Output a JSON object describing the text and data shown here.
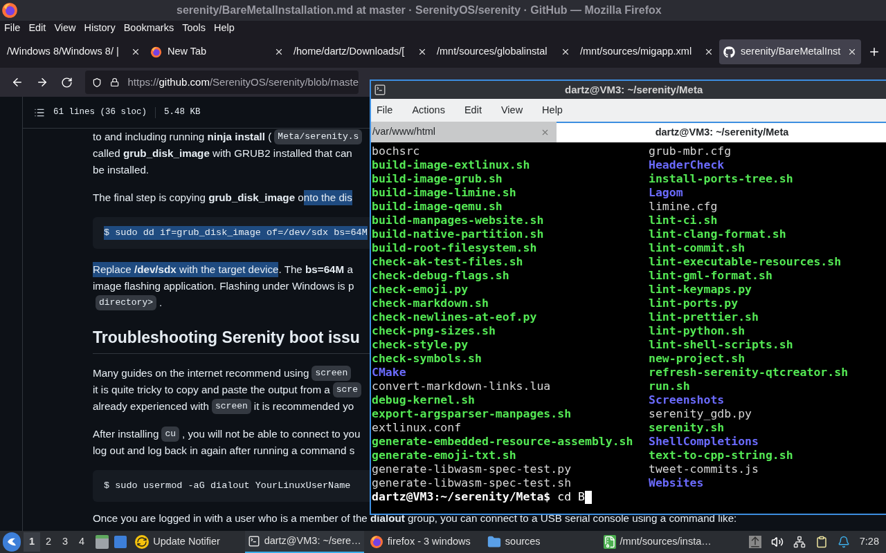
{
  "window": {
    "title": "serenity/BareMetalInstallation.md at master · SerenityOS/serenity · GitHub — Mozilla Firefox"
  },
  "menu": [
    "File",
    "Edit",
    "View",
    "History",
    "Bookmarks",
    "Tools",
    "Help"
  ],
  "tabs": [
    {
      "label": "/Windows 8/Windows 8/ |",
      "kind": "plain",
      "selected": false
    },
    {
      "label": "New Tab",
      "kind": "browser",
      "selected": false
    },
    {
      "label": "/home/dartz/Downloads/[",
      "kind": "plain",
      "selected": false
    },
    {
      "label": "/mnt/sources/globalinstal",
      "kind": "plain",
      "selected": false
    },
    {
      "label": "/mnt/sources/migapp.xml",
      "kind": "plain",
      "selected": false
    },
    {
      "label": "serenity/BareMetalInst",
      "kind": "repo",
      "selected": true
    }
  ],
  "url": {
    "scheme": "https://",
    "domain": "github.com",
    "path": "/SerenityOS/serenity/blob/maste"
  },
  "file_info": {
    "lines": "61 lines (36 sloc)",
    "size": "5.48 KB"
  },
  "article": [
    {
      "kind": "p",
      "lines": [
        [
          {
            "kind": "text",
            "text": "to and including running **ninja install** (",
            "highlighted": false
          },
          {
            "kind": "code",
            "text": "Meta/serenity.s",
            "highlighted": false
          }
        ],
        [
          {
            "kind": "text",
            "text": "called **grub_disk_image** with GRUB2 installed that can",
            "highlighted": false
          }
        ],
        [
          {
            "kind": "text",
            "text": "be installed.",
            "highlighted": false
          }
        ]
      ]
    },
    {
      "kind": "p",
      "lines": [
        [
          {
            "kind": "text",
            "text": "The final step is copying **grub_disk_image** o",
            "highlighted": false
          },
          {
            "kind": "text",
            "text": "nto the dis",
            "highlighted": true
          }
        ]
      ]
    },
    {
      "kind": "codeblock",
      "text": "$ sudo dd if=grub_disk_image of=/dev/sdx bs=64M",
      "highlighted": true
    },
    {
      "kind": "p",
      "lines": [
        [
          {
            "kind": "text",
            "text": "Replace **/dev/sdx** with the target device",
            "highlighted": true
          },
          {
            "kind": "text",
            "text": ". The **bs=64M** a",
            "highlighted": false
          }
        ],
        [
          {
            "kind": "text",
            "text": "image flashing application. Flashing under Windows is p",
            "highlighted": false
          }
        ],
        [
          {
            "kind": "code",
            "text": "directory>",
            "highlighted": false
          },
          {
            "kind": "text",
            "text": ".",
            "highlighted": false
          }
        ]
      ]
    },
    {
      "kind": "heading",
      "text": "Troubleshooting Serenity boot issu"
    },
    {
      "kind": "p",
      "lines": [
        [
          {
            "kind": "text",
            "text": "Many guides on the internet recommend using",
            "highlighted": false
          },
          {
            "kind": "code",
            "text": "screen",
            "highlighted": false
          }
        ],
        [
          {
            "kind": "text",
            "text": "it is quite tricky to copy and paste the output from a",
            "highlighted": false
          },
          {
            "kind": "code",
            "text": "scre",
            "highlighted": false
          }
        ],
        [
          {
            "kind": "text",
            "text": "already experienced with",
            "highlighted": false
          },
          {
            "kind": "code",
            "text": "screen",
            "highlighted": false
          },
          {
            "kind": "text",
            "text": "it is recommended yo",
            "highlighted": false
          }
        ]
      ]
    },
    {
      "kind": "p",
      "lines": [
        [
          {
            "kind": "text",
            "text": "After installing",
            "highlighted": false
          },
          {
            "kind": "code",
            "text": "cu",
            "highlighted": false
          },
          {
            "kind": "text",
            "text": ", you will not be able to connect to you",
            "highlighted": false
          }
        ],
        [
          {
            "kind": "text",
            "text": "log out and log back in again after running a command s",
            "highlighted": false
          }
        ]
      ]
    },
    {
      "kind": "codeblock",
      "text": "$ sudo usermod -aG dialout YourLinuxUserName",
      "highlighted": false
    },
    {
      "kind": "p",
      "lines": [
        [
          {
            "kind": "text",
            "text": "Once you are logged in with a user who is a member of the **dialout** group, you can connect to a USB serial console using a command like:",
            "highlighted": false
          }
        ]
      ]
    }
  ],
  "terminal": {
    "title": "dartz@VM3: ~/serenity/Meta",
    "menu": [
      "File",
      "Actions",
      "Edit",
      "View",
      "Help"
    ],
    "tabs": [
      {
        "label": "/var/www/html",
        "selected": false
      },
      {
        "label": "dartz@VM3: ~/serenity/Meta",
        "selected": true
      }
    ],
    "listing": [
      {
        "name": "bochsrc",
        "kind": "file"
      },
      {
        "name": "grub-mbr.cfg",
        "kind": "file"
      },
      {
        "name": "build-image-extlinux.sh",
        "kind": "exec"
      },
      {
        "name": "HeaderCheck",
        "kind": "dir"
      },
      {
        "name": "build-image-grub.sh",
        "kind": "exec"
      },
      {
        "name": "install-ports-tree.sh",
        "kind": "exec"
      },
      {
        "name": "build-image-limine.sh",
        "kind": "exec"
      },
      {
        "name": "Lagom",
        "kind": "dir"
      },
      {
        "name": "build-image-qemu.sh",
        "kind": "exec"
      },
      {
        "name": "limine.cfg",
        "kind": "file"
      },
      {
        "name": "build-manpages-website.sh",
        "kind": "exec"
      },
      {
        "name": "lint-ci.sh",
        "kind": "exec"
      },
      {
        "name": "build-native-partition.sh",
        "kind": "exec"
      },
      {
        "name": "lint-clang-format.sh",
        "kind": "exec"
      },
      {
        "name": "build-root-filesystem.sh",
        "kind": "exec"
      },
      {
        "name": "lint-commit.sh",
        "kind": "exec"
      },
      {
        "name": "check-ak-test-files.sh",
        "kind": "exec"
      },
      {
        "name": "lint-executable-resources.sh",
        "kind": "exec"
      },
      {
        "name": "check-debug-flags.sh",
        "kind": "exec"
      },
      {
        "name": "lint-gml-format.sh",
        "kind": "exec"
      },
      {
        "name": "check-emoji.py",
        "kind": "exec"
      },
      {
        "name": "lint-keymaps.py",
        "kind": "exec"
      },
      {
        "name": "check-markdown.sh",
        "kind": "exec"
      },
      {
        "name": "lint-ports.py",
        "kind": "exec"
      },
      {
        "name": "check-newlines-at-eof.py",
        "kind": "exec"
      },
      {
        "name": "lint-prettier.sh",
        "kind": "exec"
      },
      {
        "name": "check-png-sizes.sh",
        "kind": "exec"
      },
      {
        "name": "lint-python.sh",
        "kind": "exec"
      },
      {
        "name": "check-style.py",
        "kind": "exec"
      },
      {
        "name": "lint-shell-scripts.sh",
        "kind": "exec"
      },
      {
        "name": "check-symbols.sh",
        "kind": "exec"
      },
      {
        "name": "new-project.sh",
        "kind": "exec"
      },
      {
        "name": "CMake",
        "kind": "dir"
      },
      {
        "name": "refresh-serenity-qtcreator.sh",
        "kind": "exec"
      },
      {
        "name": "convert-markdown-links.lua",
        "kind": "file"
      },
      {
        "name": "run.sh",
        "kind": "exec"
      },
      {
        "name": "debug-kernel.sh",
        "kind": "exec"
      },
      {
        "name": "Screenshots",
        "kind": "dir"
      },
      {
        "name": "export-argsparser-manpages.sh",
        "kind": "exec"
      },
      {
        "name": "serenity_gdb.py",
        "kind": "file"
      },
      {
        "name": "extlinux.conf",
        "kind": "file"
      },
      {
        "name": "serenity.sh",
        "kind": "exec"
      },
      {
        "name": "generate-embedded-resource-assembly.sh",
        "kind": "exec"
      },
      {
        "name": "ShellCompletions",
        "kind": "dir"
      },
      {
        "name": "generate-emoji-txt.sh",
        "kind": "exec"
      },
      {
        "name": "text-to-cpp-string.sh",
        "kind": "exec"
      },
      {
        "name": "generate-libwasm-spec-test.py",
        "kind": "file"
      },
      {
        "name": "tweet-commits.js",
        "kind": "file"
      },
      {
        "name": "generate-libwasm-spec-test.sh",
        "kind": "file"
      },
      {
        "name": "Websites",
        "kind": "dir"
      }
    ],
    "prompt": "dartz@VM3:~/serenity/Meta$",
    "command": "cd B"
  },
  "taskbar": {
    "workspaces": [
      {
        "label": "1",
        "selected": true
      },
      {
        "label": "2",
        "selected": false
      },
      {
        "label": "3",
        "selected": false
      },
      {
        "label": "4",
        "selected": false
      }
    ],
    "tasks": [
      {
        "label": "Update Notifier",
        "kind": "updater",
        "selected": false
      },
      {
        "label": "dartz@VM3: ~/sere…",
        "kind": "terminal",
        "selected": true
      },
      {
        "label": "firefox - 3 windows",
        "kind": "browser",
        "selected": false
      },
      {
        "label": "sources",
        "kind": "files",
        "selected": false
      },
      {
        "label": "/mnt/sources/insta…",
        "kind": "archive",
        "selected": false
      }
    ],
    "clock": "7:28"
  }
}
